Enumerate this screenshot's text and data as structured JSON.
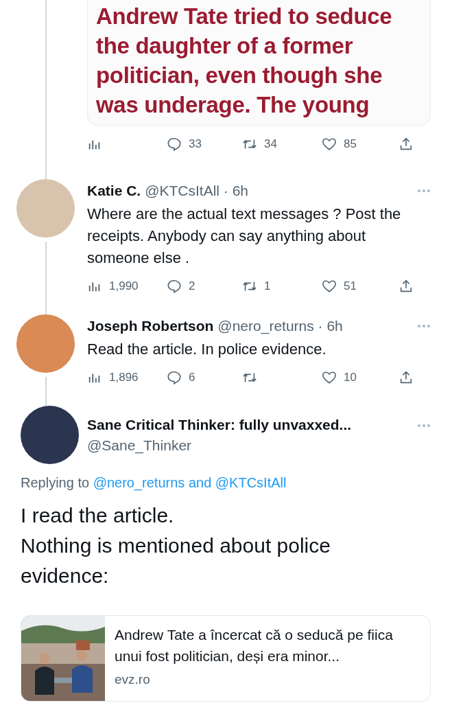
{
  "thread_head": {
    "image_text_lines": [
      "Andrew Tate tried to seduce",
      "the daughter of a former",
      "politician, even though she",
      "was underage. The young"
    ],
    "actions": {
      "replies": "33",
      "retweets": "34",
      "likes": "85"
    }
  },
  "replies": [
    {
      "name": "Katie C.",
      "handle": "@KTCsItAll",
      "separator": "·",
      "time": "6h",
      "text": "Where are the actual text messages ? Post the receipts. Anybody can say anything about someone else .",
      "actions": {
        "views": "1,990",
        "replies": "2",
        "retweets": "1",
        "likes": "51"
      }
    },
    {
      "name": "Joseph Robertson",
      "handle": "@nero_returns",
      "separator": "·",
      "time": "6h",
      "text": "Read the article. In police evidence.",
      "actions": {
        "views": "1,896",
        "replies": "6",
        "likes": "10"
      }
    }
  ],
  "main_tweet": {
    "name": "Sane Critical Thinker: fully unvaxxed...",
    "handle": "@Sane_Thinker",
    "replying_label": "Replying to",
    "replying_to": [
      "@nero_returns",
      "@KTCsItAll"
    ],
    "replying_joiner": "and",
    "text_lines": [
      "I read the article.",
      "Nothing is mentioned about police evidence:"
    ],
    "link_card": {
      "title": "Andrew Tate a încercat că o seducă pe fiica unui fost politician, deși era minor...",
      "domain": "evz.ro"
    }
  }
}
